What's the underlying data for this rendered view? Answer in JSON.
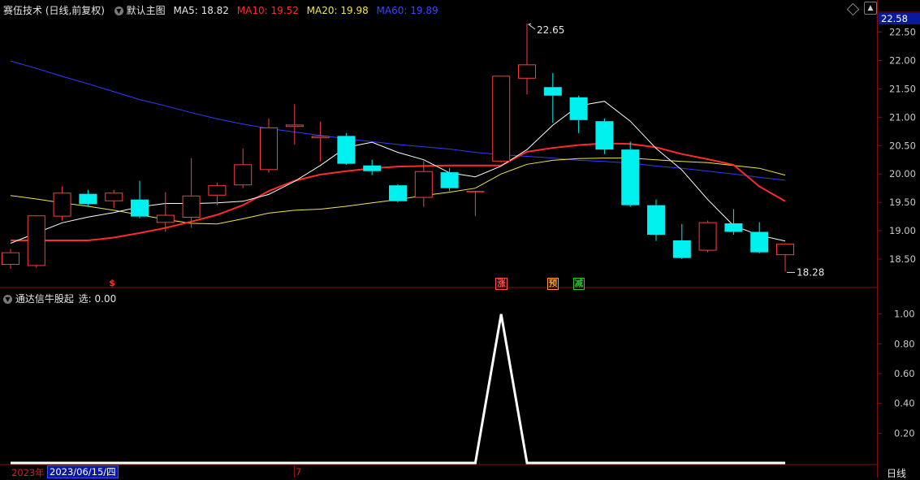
{
  "main_header": {
    "stock": "赛伍技术 (日线,前复权)",
    "template": "默认主图",
    "ma5": {
      "label": "MA5:",
      "value": "18.82",
      "color": "#ffffff"
    },
    "ma10": {
      "label": "MA10:",
      "value": "19.52",
      "color": "#ff2a2a"
    },
    "ma20": {
      "label": "MA20:",
      "value": "19.98",
      "color": "#f0e64a"
    },
    "ma60": {
      "label": "MA60:",
      "value": "19.89",
      "color": "#2f3cff"
    }
  },
  "price_axis": {
    "current_price": "22.58",
    "ticks": [
      "22.50",
      "22.00",
      "21.50",
      "21.00",
      "20.50",
      "20.00",
      "19.50",
      "19.00",
      "18.50"
    ]
  },
  "annotations": {
    "high": "22.65",
    "low": "18.28"
  },
  "signal_tags": [
    {
      "text": "$",
      "color": "#ff3030"
    },
    {
      "text": "涨",
      "color": "#ff5050"
    },
    {
      "text": "预",
      "color": "#ff9a2e"
    },
    {
      "text": "减",
      "color": "#2ec52e"
    }
  ],
  "sub_header": {
    "indicator": "通达信牛股起",
    "value": "选: 0.00"
  },
  "sub_axis": {
    "ticks": [
      "1.00",
      "0.80",
      "0.60",
      "0.40",
      "0.20"
    ]
  },
  "bottom_bar": {
    "year": "2023年",
    "date": "2023/06/15/四",
    "month_mark": "7",
    "period_button": "日线"
  },
  "chart_data": {
    "type": "candlestick",
    "y_range": [
      18.1,
      22.75
    ],
    "candles": [
      {
        "o": 18.4,
        "h": 18.68,
        "l": 18.33,
        "c": 18.62
      },
      {
        "o": 18.38,
        "h": 19.27,
        "l": 18.35,
        "c": 19.27
      },
      {
        "o": 19.25,
        "h": 19.78,
        "l": 19.18,
        "c": 19.67
      },
      {
        "o": 19.65,
        "h": 19.72,
        "l": 19.42,
        "c": 19.47
      },
      {
        "o": 19.52,
        "h": 19.72,
        "l": 19.4,
        "c": 19.67
      },
      {
        "o": 19.55,
        "h": 19.88,
        "l": 19.22,
        "c": 19.25
      },
      {
        "o": 19.14,
        "h": 19.68,
        "l": 18.98,
        "c": 19.28
      },
      {
        "o": 19.23,
        "h": 20.28,
        "l": 19.05,
        "c": 19.62
      },
      {
        "o": 19.62,
        "h": 19.85,
        "l": 19.45,
        "c": 19.8
      },
      {
        "o": 19.8,
        "h": 20.45,
        "l": 19.75,
        "c": 20.17
      },
      {
        "o": 20.07,
        "h": 20.98,
        "l": 20.02,
        "c": 20.82
      },
      {
        "o": 20.83,
        "h": 21.23,
        "l": 20.52,
        "c": 20.87
      },
      {
        "o": 20.63,
        "h": 20.92,
        "l": 20.22,
        "c": 20.67
      },
      {
        "o": 20.67,
        "h": 20.72,
        "l": 20.16,
        "c": 20.18
      },
      {
        "o": 20.15,
        "h": 20.25,
        "l": 19.98,
        "c": 20.05
      },
      {
        "o": 19.8,
        "h": 19.82,
        "l": 19.5,
        "c": 19.52
      },
      {
        "o": 19.58,
        "h": 20.23,
        "l": 19.42,
        "c": 20.05
      },
      {
        "o": 20.03,
        "h": 20.1,
        "l": 19.7,
        "c": 19.75
      },
      {
        "o": 19.7,
        "h": 19.7,
        "l": 19.26,
        "c": 19.7
      },
      {
        "o": 20.22,
        "h": 21.73,
        "l": 20.2,
        "c": 21.73
      },
      {
        "o": 21.68,
        "h": 22.65,
        "l": 21.4,
        "c": 21.93
      },
      {
        "o": 21.53,
        "h": 21.78,
        "l": 20.9,
        "c": 21.38
      },
      {
        "o": 21.35,
        "h": 21.38,
        "l": 20.72,
        "c": 20.95
      },
      {
        "o": 20.93,
        "h": 20.98,
        "l": 20.35,
        "c": 20.43
      },
      {
        "o": 20.43,
        "h": 20.57,
        "l": 19.42,
        "c": 19.45
      },
      {
        "o": 19.45,
        "h": 19.55,
        "l": 18.82,
        "c": 18.93
      },
      {
        "o": 18.83,
        "h": 19.12,
        "l": 18.5,
        "c": 18.52
      },
      {
        "o": 18.65,
        "h": 19.18,
        "l": 18.62,
        "c": 19.15
      },
      {
        "o": 19.13,
        "h": 19.38,
        "l": 18.93,
        "c": 18.98
      },
      {
        "o": 18.98,
        "h": 19.15,
        "l": 18.6,
        "c": 18.62
      },
      {
        "o": 18.57,
        "h": 18.78,
        "l": 18.28,
        "c": 18.77
      }
    ],
    "ma5": [
      18.78,
      18.96,
      19.14,
      19.24,
      19.32,
      19.42,
      19.48,
      19.48,
      19.49,
      19.52,
      19.64,
      19.87,
      20.15,
      20.47,
      20.56,
      20.38,
      20.25,
      20.02,
      19.95,
      20.14,
      20.43,
      20.86,
      21.2,
      21.28,
      20.93,
      20.45,
      20.07,
      19.55,
      19.09,
      18.92,
      18.82
    ],
    "ma10": [
      18.83,
      18.83,
      18.83,
      18.83,
      18.88,
      18.96,
      19.05,
      19.16,
      19.28,
      19.45,
      19.7,
      19.88,
      19.99,
      20.05,
      20.1,
      20.13,
      20.14,
      20.15,
      20.15,
      20.15,
      20.39,
      20.46,
      20.51,
      20.54,
      20.53,
      20.47,
      20.35,
      20.26,
      20.16,
      19.78,
      19.52
    ],
    "ma20": [
      19.62,
      19.56,
      19.49,
      19.43,
      19.36,
      19.28,
      19.2,
      19.13,
      19.12,
      19.21,
      19.31,
      19.36,
      19.38,
      19.43,
      19.49,
      19.55,
      19.62,
      19.68,
      19.75,
      20.0,
      20.17,
      20.24,
      20.27,
      20.28,
      20.28,
      20.25,
      20.22,
      20.2,
      20.15,
      20.1,
      19.98
    ],
    "ma60": [
      21.99,
      21.86,
      21.72,
      21.59,
      21.45,
      21.31,
      21.2,
      21.08,
      20.97,
      20.88,
      20.8,
      20.74,
      20.68,
      20.62,
      20.57,
      20.52,
      20.48,
      20.44,
      20.38,
      20.34,
      20.31,
      20.28,
      20.24,
      20.22,
      20.19,
      20.14,
      20.1,
      20.05,
      20.0,
      19.94,
      19.89
    ],
    "signal_values": [
      0,
      0,
      0,
      0,
      0,
      0,
      0,
      0,
      0,
      0,
      0,
      0,
      0,
      0,
      0,
      0,
      0,
      0,
      0,
      1,
      0,
      0,
      0,
      0,
      0,
      0,
      0,
      0,
      0,
      0,
      0
    ],
    "signal_range": [
      0,
      1.08
    ]
  },
  "colors": {
    "up": "#ff3c3c",
    "down": "#00f0f0",
    "frame": "#8a0d0d"
  }
}
